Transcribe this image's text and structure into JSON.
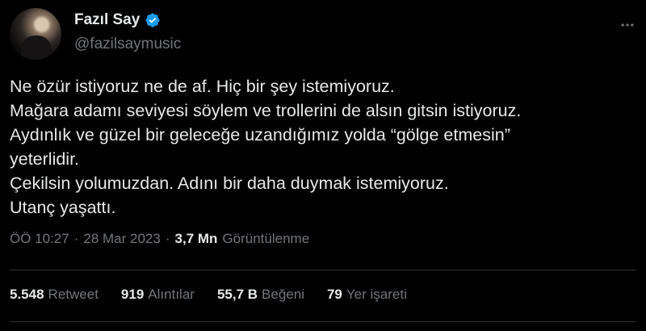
{
  "author": {
    "display_name": "Fazıl Say",
    "handle": "@fazilsaymusic",
    "verified_icon": "verified-badge-icon",
    "verified_color": "#1d9bf0"
  },
  "tweet": {
    "lines": [
      "Ne özür istiyoruz ne de af. Hiç bir şey istemiyoruz.",
      "Mağara adamı seviyesi söylem ve trollerini de alsın gitsin istiyoruz.",
      "Aydınlık ve güzel bir geleceğe uzandığımız yolda “gölge etmesin”",
      "yeterlidir.",
      "Çekilsin yolumuzdan. Adını bir daha duymak istemiyoruz.",
      "Utanç yaşattı."
    ]
  },
  "meta": {
    "time": "ÖÖ 10:27",
    "sep1": "·",
    "date": "28 Mar 2023",
    "sep2": "·",
    "views_count": "3,7 Mn",
    "views_label": "Görüntülenme"
  },
  "stats": [
    {
      "count": "5.548",
      "label": "Retweet"
    },
    {
      "count": "919",
      "label": "Alıntılar"
    },
    {
      "count": "55,7 B",
      "label": "Beğeni"
    },
    {
      "count": "79",
      "label": "Yer işareti"
    }
  ],
  "colors": {
    "background": "#000000",
    "text_primary": "#e7e9ea",
    "text_secondary": "#71767b",
    "divider": "#2f3336"
  }
}
